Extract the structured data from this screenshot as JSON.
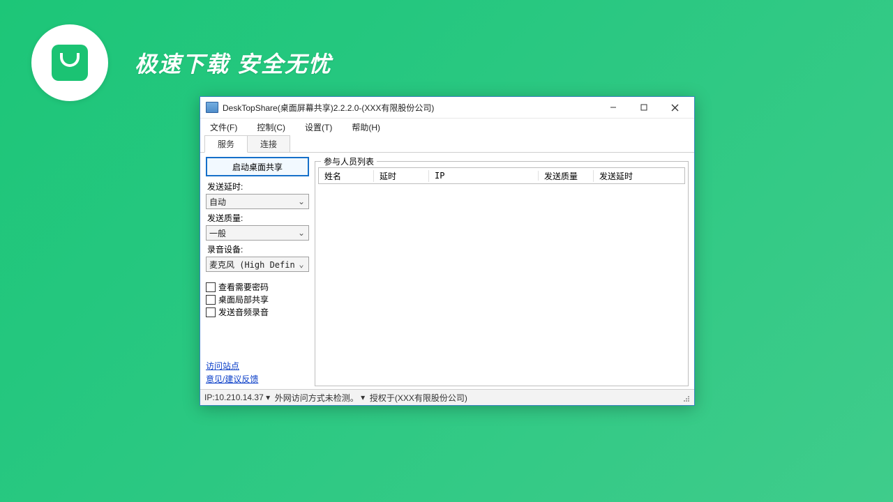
{
  "promo": {
    "text": "极速下载  安全无忧"
  },
  "window": {
    "title": "DeskTopShare(桌面屏幕共享)2.2.2.0-(XXX有限股份公司)"
  },
  "menu": {
    "file": "文件(F)",
    "control": "控制(C)",
    "settings": "设置(T)",
    "help": "帮助(H)"
  },
  "tabs": {
    "service": "服务",
    "connect": "连接"
  },
  "panel": {
    "start_share": "启动桌面共享",
    "send_delay_label": "发送延时:",
    "send_delay_value": "自动",
    "send_quality_label": "发送质量:",
    "send_quality_value": "一般",
    "record_device_label": "录音设备:",
    "record_device_value": "麦克风 (High Defin",
    "chk_view_pwd": "查看需要密码",
    "chk_partial": "桌面局部共享",
    "chk_audio": "发送音频录音",
    "link_visit": "访问站点",
    "link_feedback": "意见/建议反馈"
  },
  "participants": {
    "legend": "参与人员列表",
    "cols": {
      "name": "姓名",
      "delay": "延时",
      "ip": "IP",
      "send_quality": "发送质量",
      "send_delay": "发送延时"
    }
  },
  "status": {
    "ip": "IP:10.210.14.37",
    "net": "外网访问方式未检测。",
    "license": "授权于(XXX有限股份公司)"
  }
}
